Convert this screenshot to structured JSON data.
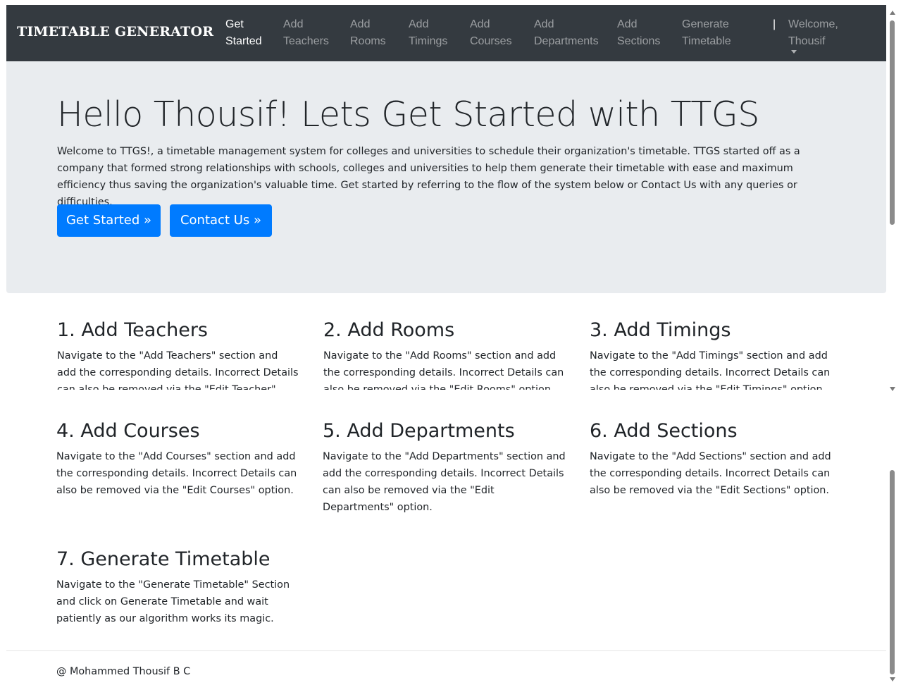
{
  "navbar": {
    "brand": "TIMETABLE GENERATOR",
    "items": [
      {
        "line1": "Get",
        "line2": "Started"
      },
      {
        "line1": "Add",
        "line2": "Teachers"
      },
      {
        "line1": "Add",
        "line2": "Rooms"
      },
      {
        "line1": "Add",
        "line2": "Timings"
      },
      {
        "line1": "Add",
        "line2": "Courses"
      },
      {
        "line1": "Add",
        "line2": "Departments"
      },
      {
        "line1": "Add",
        "line2": "Sections"
      },
      {
        "line1": "Generate",
        "line2": "Timetable"
      }
    ],
    "separator": "|",
    "user": {
      "line1": "Welcome,",
      "line2": "Thousif"
    }
  },
  "hero": {
    "title": "Hello Thousif! Lets Get Started with TTGS",
    "text": "Welcome to TTGS!, a timetable management system for colleges and universities to schedule their organization's timetable. TTGS started off as a company that formed strong relationships with schools, colleges and universities to help them generate their timetable with ease and maximum efficiency thus saving the organization's valuable time. Get started by referring to the flow of the system below or Contact Us with any queries or difficulties.",
    "get_started_label": "Get Started »",
    "contact_label": "Contact Us »"
  },
  "steps": [
    {
      "title": "1. Add Teachers",
      "text": "Navigate to the \"Add Teachers\" section and add the corresponding details. Incorrect Details can also be removed via the \"Edit Teacher\" option."
    },
    {
      "title": "2. Add Rooms",
      "text": "Navigate to the \"Add Rooms\" section and add the corresponding details. Incorrect Details can also be removed via the \"Edit Rooms\" option."
    },
    {
      "title": "3. Add Timings",
      "text": "Navigate to the \"Add Timings\" section and add the corresponding details. Incorrect Details can also be removed via the \"Edit Timings\" option."
    },
    {
      "title": "4. Add Courses",
      "text": "Navigate to the \"Add Courses\" section and add the corresponding details. Incorrect Details can also be removed via the \"Edit Courses\" option."
    },
    {
      "title": "5. Add Departments",
      "text": "Navigate to the \"Add Departments\" section and add the corresponding details. Incorrect Details can also be removed via the \"Edit Departments\" option."
    },
    {
      "title": "6. Add Sections",
      "text": "Navigate to the \"Add Sections\" section and add the corresponding details. Incorrect Details can also be removed via the \"Edit Sections\" option."
    },
    {
      "title": "7. Generate Timetable",
      "text": "Navigate to the \"Generate Timetable\" Section and click on Generate Timetable and wait patiently as our algorithm works its magic."
    }
  ],
  "footer": {
    "text": "@ Mohammed Thousif B C"
  },
  "colors": {
    "navbar_bg": "#343a40",
    "hero_bg": "#e9ecef",
    "primary": "#007bff"
  }
}
